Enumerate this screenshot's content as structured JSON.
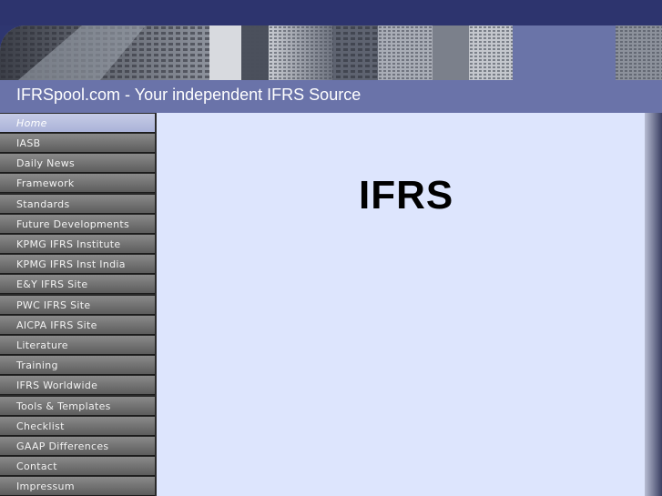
{
  "header": {
    "site_title": "IFRSpool.com - Your independent IFRS Source"
  },
  "sidebar": {
    "items": [
      {
        "label": "Home",
        "active": true
      },
      {
        "label": "IASB"
      },
      {
        "label": "Daily News"
      },
      {
        "label": "Framework"
      },
      {
        "label": "Standards"
      },
      {
        "label": "Future Developments"
      },
      {
        "label": "KPMG IFRS Institute"
      },
      {
        "label": "KPMG IFRS Inst India"
      },
      {
        "label": "E&Y IFRS Site"
      },
      {
        "label": "PWC IFRS Site"
      },
      {
        "label": "AICPA IFRS Site"
      },
      {
        "label": "Literature"
      },
      {
        "label": "Training"
      },
      {
        "label": "IFRS Worldwide"
      },
      {
        "label": "Tools & Templates"
      },
      {
        "label": "Checklist"
      },
      {
        "label": "GAAP Differences"
      },
      {
        "label": "Contact"
      },
      {
        "label": "Impressum"
      }
    ]
  },
  "main": {
    "heading": "IFRS"
  },
  "colors": {
    "top_band": "#2d346e",
    "title_bar": "#6a73a9",
    "content_bg": "#dde5fd",
    "nav_active": "#b8bfe0"
  }
}
